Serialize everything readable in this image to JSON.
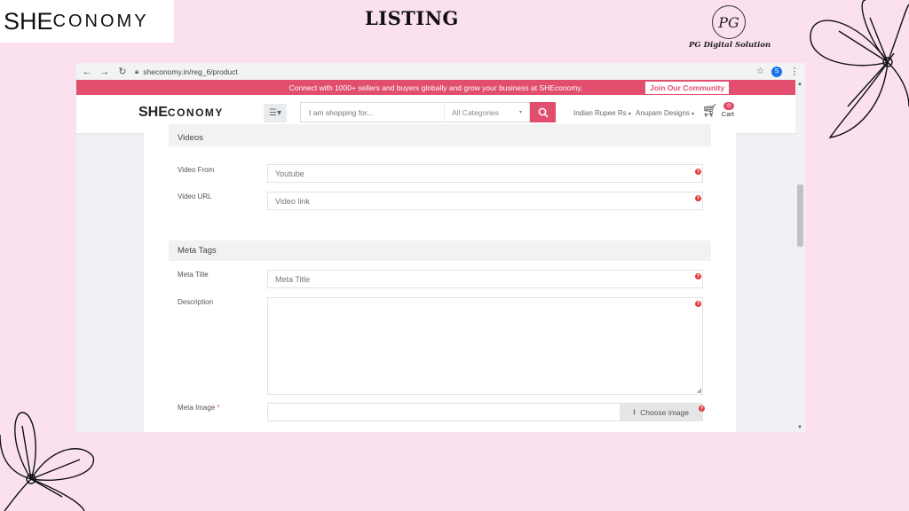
{
  "slide": {
    "logo_she": "SHE",
    "logo_conomy": "conomy",
    "title": "LISTING",
    "pg_mark": "PG",
    "pg_company": "PG Digital Solution"
  },
  "browser": {
    "url": "sheconomy.in/reg_6/product",
    "profile_initial": "S"
  },
  "site": {
    "promo_text": "Connect with 1000+ sellers and buyers globally and grow your business at SHEconomy.",
    "join_label": "Join Our Community",
    "logo_she": "SHE",
    "logo_conomy": "conomy",
    "search_placeholder": "I am shopping for...",
    "category_label": "All Categories",
    "currency_label": "Indian Rupee Rs",
    "account_label": "Anupam Designs",
    "cart_label": "Cart",
    "cart_count": "0"
  },
  "form": {
    "videos_heading": "Videos",
    "video_from_label": "Video From",
    "video_from_value": "Youtube",
    "video_url_label": "Video URL",
    "video_url_placeholder": "Video link",
    "meta_heading": "Meta Tags",
    "meta_title_label": "Meta Title",
    "meta_title_placeholder": "Meta Title",
    "description_label": "Description",
    "meta_image_label": "Meta Image",
    "required_mark": "*",
    "choose_image_label": "Choose image"
  },
  "colors": {
    "accent": "#e14e6e",
    "slide_bg": "#fbe1ef"
  }
}
